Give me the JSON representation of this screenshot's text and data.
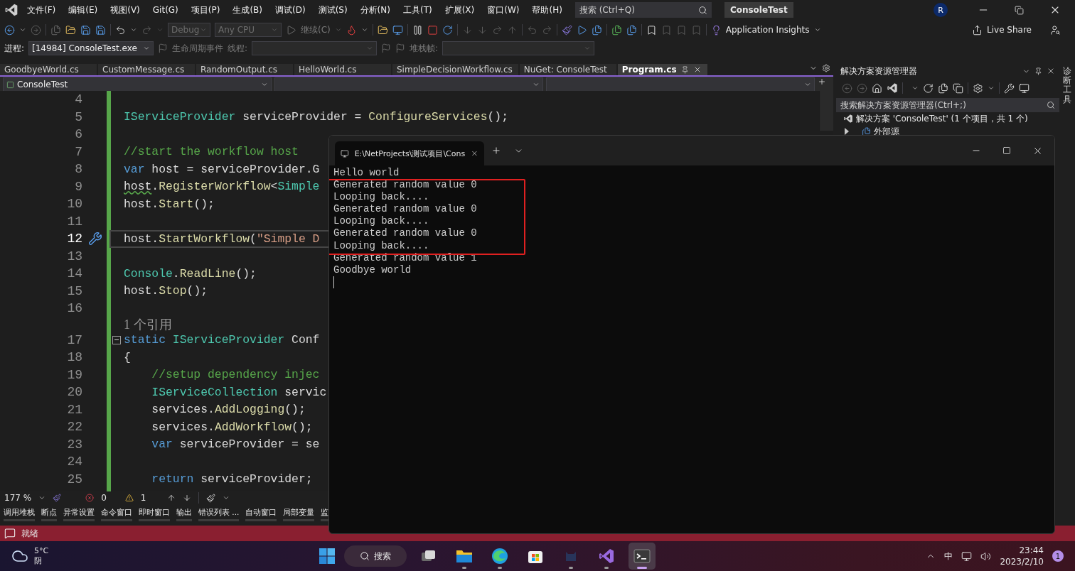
{
  "menu": [
    "文件(F)",
    "编辑(E)",
    "视图(V)",
    "Git(G)",
    "项目(P)",
    "生成(B)",
    "调试(D)",
    "测试(S)",
    "分析(N)",
    "工具(T)",
    "扩展(X)",
    "窗口(W)",
    "帮助(H)"
  ],
  "search": {
    "placeholder": "搜索 (Ctrl+Q)"
  },
  "title": "ConsoleTest",
  "account": {
    "initial": "R"
  },
  "toolbar": {
    "configuration": "Debug",
    "platform": "Any CPU",
    "continue": "继续(C)",
    "insights": "Application Insights",
    "live_share": "Live Share"
  },
  "debug_bar": {
    "process_label": "进程:",
    "process": "[14984] ConsoleTest.exe",
    "lifecycle": "生命周期事件",
    "thread_label": "线程:",
    "stack_label": "堆栈帧:"
  },
  "editor": {
    "tabs": [
      {
        "label": "GoodbyeWorld.cs",
        "selected": false
      },
      {
        "label": "CustomMessage.cs",
        "selected": false
      },
      {
        "label": "RandomOutput.cs",
        "selected": false
      },
      {
        "label": "HelloWorld.cs",
        "selected": false
      },
      {
        "label": "SimpleDecisionWorkflow.cs",
        "selected": false
      },
      {
        "label": "NuGet: ConsoleTest",
        "selected": false
      },
      {
        "label": "Program.cs",
        "selected": true
      }
    ],
    "project": "ConsoleTest",
    "lines": [
      {
        "kind": "code",
        "number": "4",
        "current": false,
        "fold": false
      },
      {
        "kind": "code",
        "number": "5",
        "current": false,
        "fold": false,
        "tokens": [
          {
            "kind": "type",
            "text": "IServiceProvider"
          },
          {
            "kind": "plain",
            "text": " serviceProvider = "
          },
          {
            "kind": "method",
            "text": "ConfigureServices"
          },
          {
            "kind": "plain",
            "text": "();"
          }
        ]
      },
      {
        "kind": "code",
        "number": "6",
        "current": false,
        "fold": false
      },
      {
        "kind": "code",
        "number": "7",
        "current": false,
        "fold": false,
        "tokens": [
          {
            "kind": "comment",
            "text": "//start the workflow host"
          }
        ]
      },
      {
        "kind": "code",
        "number": "8",
        "current": false,
        "fold": false,
        "tokens": [
          {
            "kind": "keyword",
            "text": "var"
          },
          {
            "kind": "plain",
            "text": " host = serviceProvider.G"
          }
        ]
      },
      {
        "kind": "code",
        "number": "9",
        "current": false,
        "fold": false,
        "tokens": [
          {
            "kind": "warning",
            "text": "host"
          },
          {
            "kind": "plain",
            "text": "."
          },
          {
            "kind": "method",
            "text": "RegisterWorkflow"
          },
          {
            "kind": "plain",
            "text": "<"
          },
          {
            "kind": "type",
            "text": "Simple"
          }
        ]
      },
      {
        "kind": "code",
        "number": "10",
        "current": false,
        "fold": false,
        "tokens": [
          {
            "kind": "plain",
            "text": "host."
          },
          {
            "kind": "method",
            "text": "Start"
          },
          {
            "kind": "plain",
            "text": "();"
          }
        ]
      },
      {
        "kind": "code",
        "number": "11",
        "current": false,
        "fold": false
      },
      {
        "kind": "code",
        "number": "12",
        "current": true,
        "fold": false,
        "tokens": [
          {
            "kind": "plain",
            "text": "host."
          },
          {
            "kind": "method",
            "text": "StartWorkflow"
          },
          {
            "kind": "plain",
            "text": "("
          },
          {
            "kind": "string",
            "text": "\"Simple D"
          }
        ]
      },
      {
        "kind": "code",
        "number": "13",
        "current": false,
        "fold": false
      },
      {
        "kind": "code",
        "number": "14",
        "current": false,
        "fold": false,
        "tokens": [
          {
            "kind": "type",
            "text": "Console"
          },
          {
            "kind": "plain",
            "text": "."
          },
          {
            "kind": "method",
            "text": "ReadLine"
          },
          {
            "kind": "plain",
            "text": "();"
          }
        ]
      },
      {
        "kind": "code",
        "number": "15",
        "current": false,
        "fold": false,
        "tokens": [
          {
            "kind": "plain",
            "text": "host."
          },
          {
            "kind": "method",
            "text": "Stop"
          },
          {
            "kind": "plain",
            "text": "();"
          }
        ]
      },
      {
        "kind": "code",
        "number": "16",
        "current": false,
        "fold": false
      },
      {
        "kind": "lens",
        "text": "1 个引用",
        "current": false,
        "fold": false
      },
      {
        "kind": "code",
        "number": "17",
        "current": false,
        "fold": true,
        "tokens": [
          {
            "kind": "keyword",
            "text": "static "
          },
          {
            "kind": "type",
            "text": "IServiceProvider"
          },
          {
            "kind": "plain",
            "text": " Conf"
          }
        ]
      },
      {
        "kind": "code",
        "number": "18",
        "current": false,
        "fold": false,
        "tokens": [
          {
            "kind": "plain",
            "text": "{"
          }
        ]
      },
      {
        "kind": "code",
        "number": "19",
        "current": false,
        "fold": false,
        "tokens": [
          {
            "kind": "comment",
            "text": "    //setup dependency injec"
          }
        ]
      },
      {
        "kind": "code",
        "number": "20",
        "current": false,
        "fold": false,
        "tokens": [
          {
            "kind": "type",
            "text": "    IServiceCollection"
          },
          {
            "kind": "plain",
            "text": " servic"
          }
        ]
      },
      {
        "kind": "code",
        "number": "21",
        "current": false,
        "fold": false,
        "tokens": [
          {
            "kind": "plain",
            "text": "    services."
          },
          {
            "kind": "method",
            "text": "AddLogging"
          },
          {
            "kind": "plain",
            "text": "();"
          }
        ]
      },
      {
        "kind": "code",
        "number": "22",
        "current": false,
        "fold": false,
        "tokens": [
          {
            "kind": "plain",
            "text": "    services."
          },
          {
            "kind": "method",
            "text": "AddWorkflow"
          },
          {
            "kind": "plain",
            "text": "();"
          }
        ]
      },
      {
        "kind": "code",
        "number": "23",
        "current": false,
        "fold": false,
        "tokens": [
          {
            "kind": "keyword",
            "text": "    var"
          },
          {
            "kind": "plain",
            "text": " serviceProvider = se"
          }
        ]
      },
      {
        "kind": "code",
        "number": "24",
        "current": false,
        "fold": false
      },
      {
        "kind": "code",
        "number": "25",
        "current": false,
        "fold": false,
        "tokens": [
          {
            "kind": "keyword",
            "text": "    return"
          },
          {
            "kind": "plain",
            "text": " serviceProvider;"
          }
        ]
      }
    ],
    "zoom": "177 %",
    "errors": "0",
    "warnings": "1"
  },
  "tool_windows": [
    "调用堆栈",
    "断点",
    "异常设置",
    "命令窗口",
    "即时窗口",
    "输出",
    "错误列表 ...",
    "自动窗口",
    "局部变量",
    "监"
  ],
  "status": "就绪",
  "solution_explorer": {
    "title": "解决方案资源管理器",
    "search": {
      "placeholder": "搜索解决方案资源管理器(Ctrl+;)"
    },
    "tree": [
      {
        "label": "解决方案 'ConsoleTest' (1 个项目，共 1 个)",
        "children": [
          {
            "label": "外部源",
            "expanded": false
          }
        ]
      }
    ]
  },
  "side_strip": "诊断工具",
  "console": {
    "tab": "E:\\NetProjects\\测试项目\\Cons",
    "lines": [
      "Hello world",
      "Generated random value 0",
      "Looping back....",
      "Generated random value 0",
      "Looping back....",
      "Generated random value 0",
      "Looping back....",
      "Generated random value 1",
      "Goodbye world"
    ]
  },
  "taskbar": {
    "weather": {
      "temperature": "5°C",
      "condition": "阴"
    },
    "search": "搜索",
    "apps": [
      {
        "kind": "taskview",
        "running": false,
        "selected": false
      },
      {
        "kind": "explorer",
        "running": true,
        "selected": false
      },
      {
        "kind": "edge",
        "running": true,
        "selected": false
      },
      {
        "kind": "store",
        "running": false,
        "selected": false
      },
      {
        "kind": "cat",
        "running": true,
        "selected": false
      },
      {
        "kind": "studio",
        "running": true,
        "selected": false
      },
      {
        "kind": "terminal",
        "running": true,
        "selected": true
      }
    ],
    "ime": "中",
    "time": "23:44",
    "date": "2023/2/10",
    "notifications": "1"
  }
}
